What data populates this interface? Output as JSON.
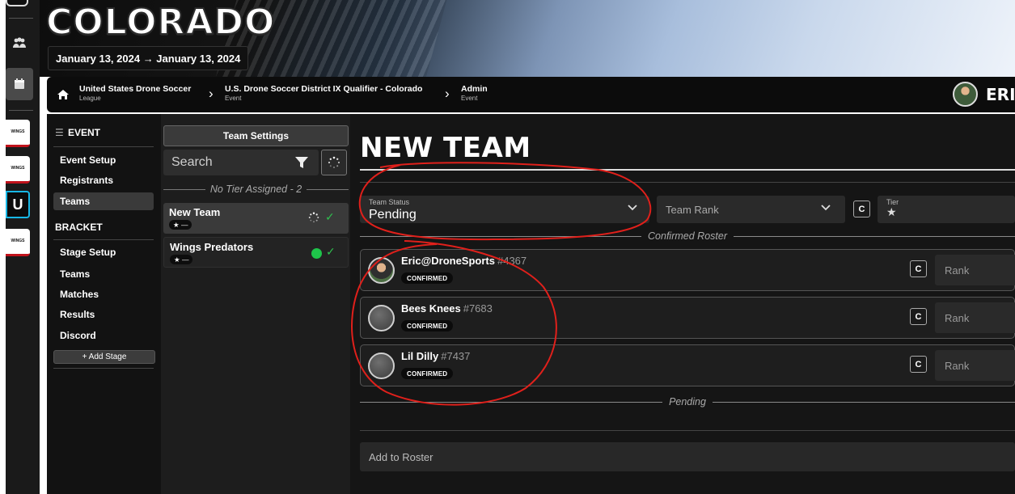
{
  "banner": {
    "title": "COLORADO",
    "date_range": "January 13, 2024 → January 13, 2024"
  },
  "breadcrumb": {
    "items": [
      {
        "label": "United States Drone Soccer",
        "sublabel": "League"
      },
      {
        "label": "U.S. Drone Soccer District IX Qualifier - Colorado",
        "sublabel": "Event"
      },
      {
        "label": "Admin",
        "sublabel": "Event"
      }
    ],
    "separator": "›"
  },
  "user": {
    "name": "ERIC"
  },
  "rail": {
    "logos": [
      {
        "label": "WINGS"
      },
      {
        "label": "WINGS"
      },
      {
        "label": "U"
      },
      {
        "label": "WINGS"
      }
    ]
  },
  "event_nav": {
    "event_header": "EVENT",
    "event_items": [
      "Event Setup",
      "Registrants",
      "Teams"
    ],
    "bracket_header": "BRACKET",
    "bracket_items": [
      "Stage Setup",
      "Teams",
      "Matches",
      "Results",
      "Discord"
    ],
    "add_stage_label": "+ Add Stage"
  },
  "team_list": {
    "settings_button": "Team Settings",
    "search_placeholder": "Search",
    "tier_group": "No Tier Assigned - 2",
    "teams": [
      {
        "name": "New Team",
        "badge_text": "★ —",
        "status": "pending"
      },
      {
        "name": "Wings Predators",
        "badge_text": "★ —",
        "status": "active"
      }
    ]
  },
  "team_form": {
    "title": "NEW TEAM",
    "status_label": "Team Status",
    "status_value": "Pending",
    "rank_placeholder": "Team Rank",
    "tier_label": "Tier",
    "confirmed_divider": "Confirmed Roster",
    "pending_divider": "Pending",
    "add_roster_placeholder": "Add to Roster"
  },
  "roster": [
    {
      "name": "Eric@DroneSports",
      "tag": "#4367",
      "badge": "CONFIRMED",
      "rank_placeholder": "Rank",
      "has_photo": true
    },
    {
      "name": "Bees Knees",
      "tag": "#7683",
      "badge": "CONFIRMED",
      "rank_placeholder": "Rank",
      "has_photo": false
    },
    {
      "name": "Lil Dilly",
      "tag": "#7437",
      "badge": "CONFIRMED",
      "rank_placeholder": "Rank",
      "has_photo": false
    }
  ],
  "colors": {
    "annotation_red": "#e0201b",
    "success_green": "#1ec44a",
    "logo_accent_red": "#c0121b",
    "logo_accent_cyan": "#17b7e6"
  }
}
